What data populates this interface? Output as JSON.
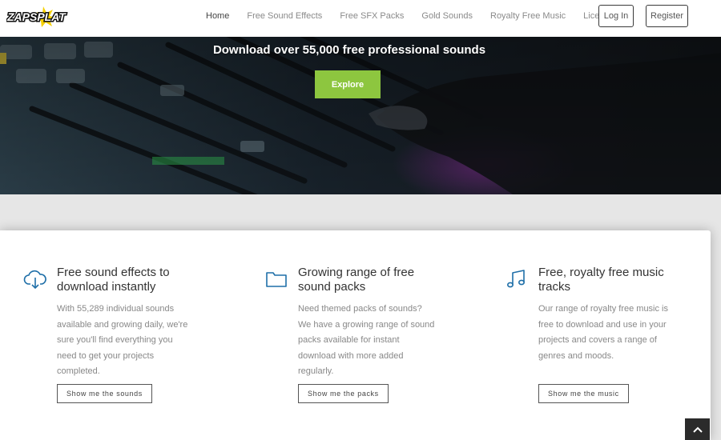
{
  "brand": {
    "logo_text": "ZAPSPLAT"
  },
  "nav": {
    "items": [
      {
        "label": "Home",
        "active": true
      },
      {
        "label": "Free Sound Effects"
      },
      {
        "label": "Free SFX Packs"
      },
      {
        "label": "Gold Sounds"
      },
      {
        "label": "Royalty Free Music"
      },
      {
        "label": "Licensing"
      }
    ],
    "login_label": "Log In",
    "register_label": "Register"
  },
  "hero": {
    "title": "Download over 55,000 free professional sounds",
    "cta_label": "Explore"
  },
  "features": [
    {
      "icon": "cloud-download-icon",
      "title_line1": "Free sound effects to",
      "title_line2": "download instantly",
      "text": "With 55,289 individual sounds available and growing daily, we're sure you'll find everything you need to get your projects completed.",
      "button_label": "Show me the sounds"
    },
    {
      "icon": "folder-icon",
      "title_line1": "Growing range of free",
      "title_line2": "sound packs",
      "text": "Need themed packs of sounds? We have a growing range of sound packs available for instant download with more added regularly.",
      "button_label": "Show me the packs"
    },
    {
      "icon": "music-note-icon",
      "title_line1": "Free, royalty free music",
      "title_line2": "tracks",
      "text": "Our range of royalty free music is free to download and use in your projects and covers a range of genres and moods.",
      "button_label": "Show me the music"
    }
  ],
  "colors": {
    "accent": "#8dc63f",
    "icon_blue": "#1f6fa8",
    "logo_yellow": "#f5d000",
    "dark": "#2b2b2b"
  }
}
